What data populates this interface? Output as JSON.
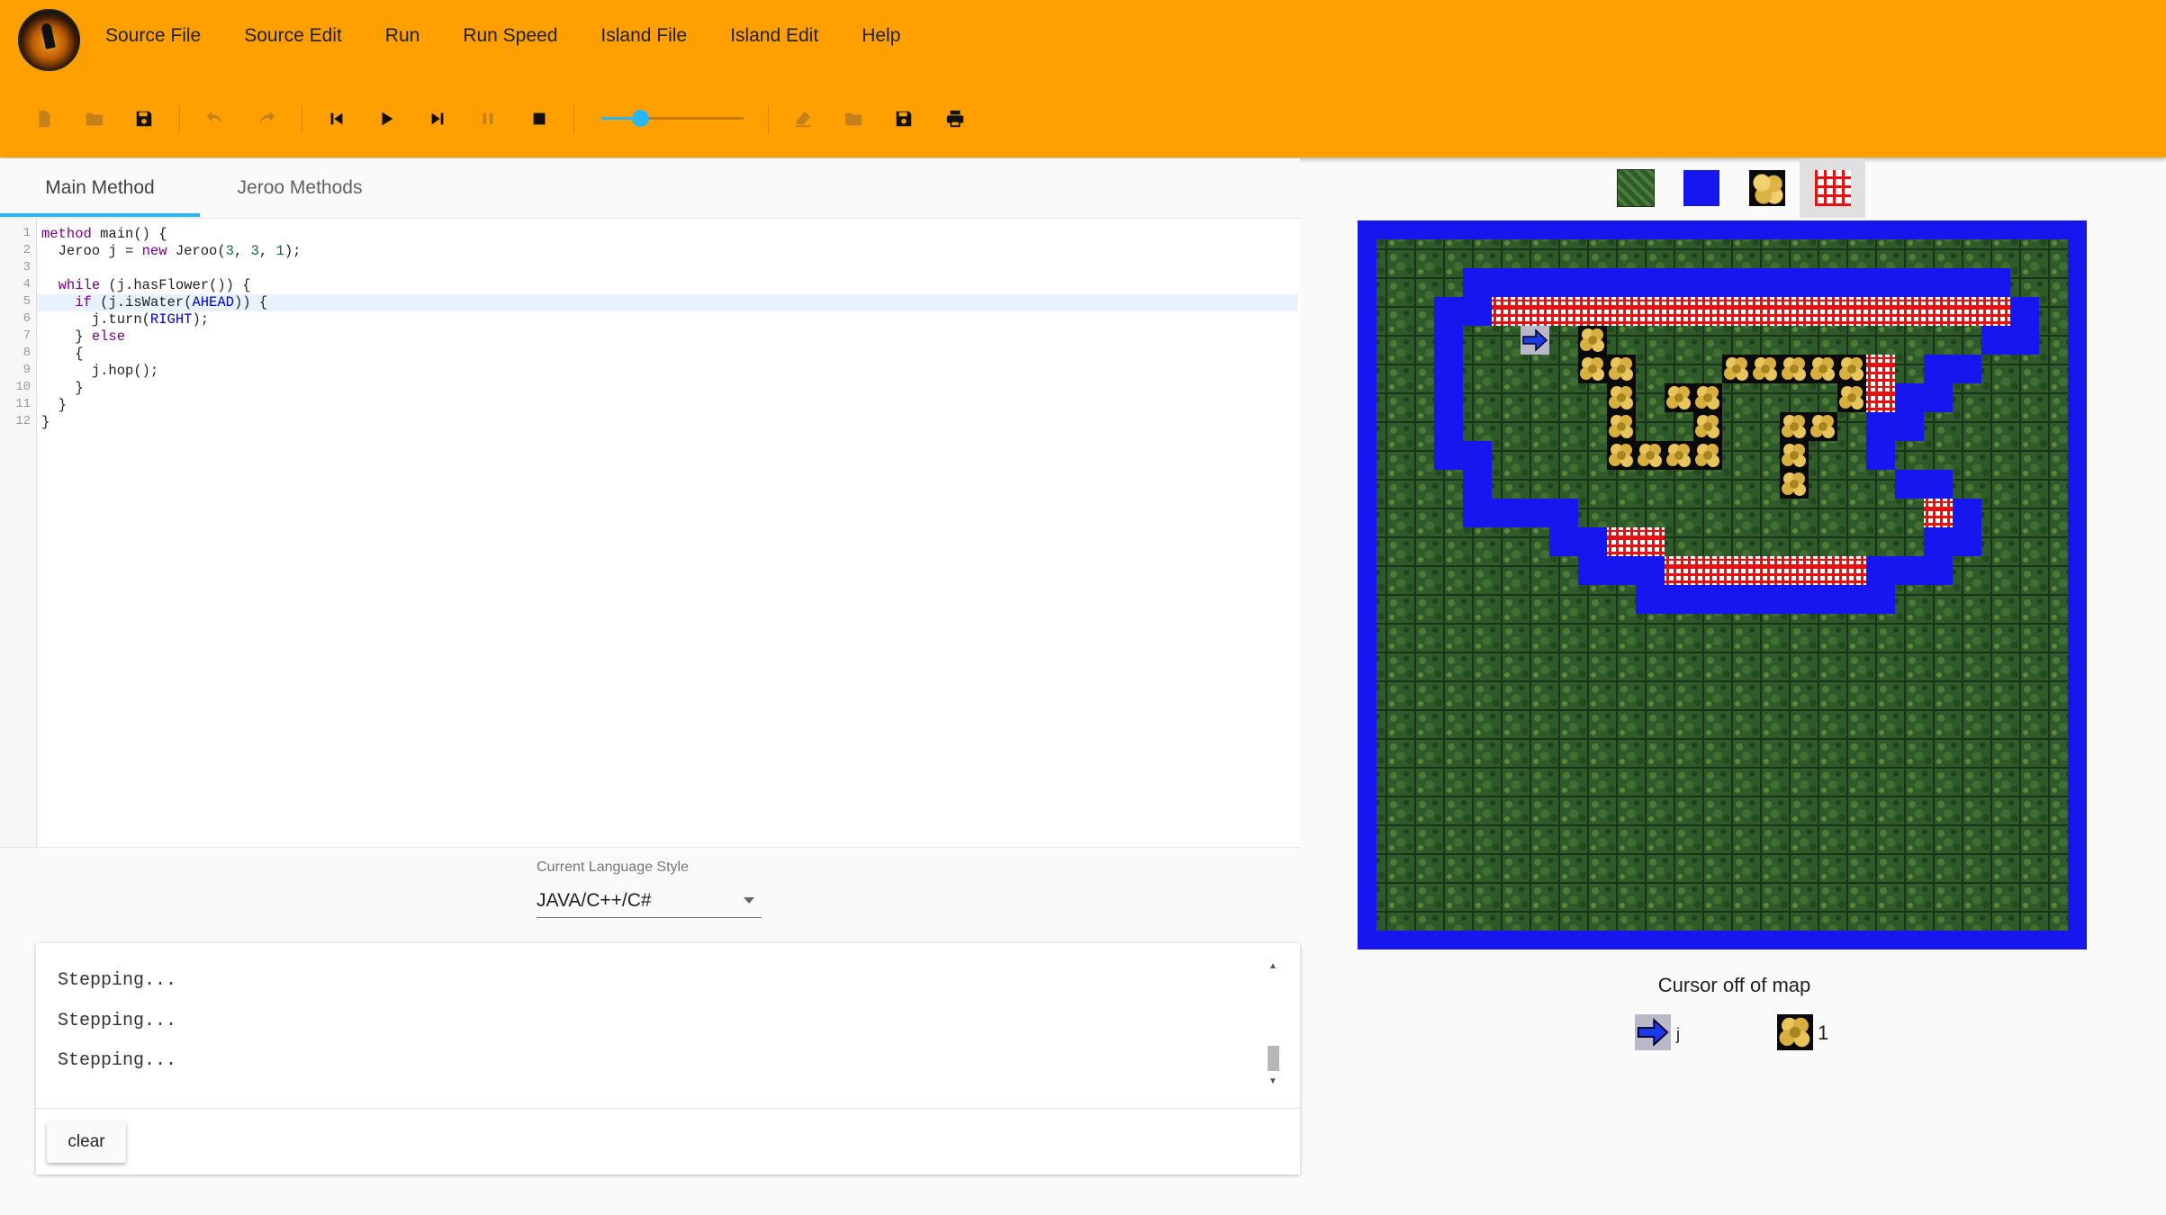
{
  "app": {
    "logo": "jeroo-logo"
  },
  "menu": [
    "Source File",
    "Source Edit",
    "Run",
    "Run Speed",
    "Island File",
    "Island Edit",
    "Help"
  ],
  "toolbar": {
    "icons": [
      "new-file-icon",
      "open-folder-icon",
      "save-icon",
      "undo-icon",
      "redo-icon",
      "reset-icon",
      "play-icon",
      "step-icon",
      "pause-icon",
      "stop-icon",
      "clear-island-icon",
      "open-island-icon",
      "save-island-icon",
      "print-icon"
    ],
    "speed_level": 0.27
  },
  "tabs": {
    "main": "Main Method",
    "jeroo": "Jeroo Methods"
  },
  "editor": {
    "line_numbers": [
      "1",
      "2",
      "3",
      "4",
      "5",
      "6",
      "7",
      "8",
      "9",
      "10",
      "11",
      "12"
    ],
    "current_line": 5,
    "tokens": {
      "l1a": "method",
      "l1b": " main() {",
      "l2a": "  Jeroo j = ",
      "l2b": "new",
      "l2c": " Jeroo(",
      "l2d": "3",
      "l2e": ", ",
      "l2f": "3",
      "l2g": ", ",
      "l2h": "1",
      "l2i": ");",
      "l4a": "  ",
      "l4b": "while",
      "l4c": " (j.hasFlower()) {",
      "l5a": "    ",
      "l5b": "if",
      "l5c": " (j.isWater(",
      "l5d": "AHEAD",
      "l5e": ")) {",
      "l6a": "      j.turn(",
      "l6b": "RIGHT",
      "l6c": ");",
      "l7a": "    } ",
      "l7b": "else",
      "l8": "    {",
      "l9": "      j.hop();",
      "l10": "    }",
      "l11": "  }",
      "l12": "}"
    }
  },
  "language": {
    "label": "Current Language Style",
    "value": "JAVA/C++/C#"
  },
  "console": {
    "lines": [
      "Stepping...",
      "Stepping...",
      "Stepping..."
    ],
    "clear_label": "clear"
  },
  "palette": [
    {
      "name": "grass",
      "color": "#2f5a2a"
    },
    {
      "name": "water",
      "color": "#1616ee"
    },
    {
      "name": "flower",
      "color": "#e8c45a"
    },
    {
      "name": "net",
      "color": "#e81010"
    }
  ],
  "colors": {
    "accent": "#ffa000",
    "water": "#1616ee",
    "grass": "#2a4d27",
    "net": "#e81010",
    "flower": "#e8c45a",
    "ink": "#29b6f6"
  },
  "map": {
    "rows": [
      "WWWWWWWWWWWWWWWWWWWWWWWWWW",
      "WGGGGGGGGGGGGGGGGGGGGGGGGW",
      "WGGGWWWWWWWWWWWWWWWWWWWGGW",
      "WGGWWNNNNNNNNNNNNNNNNNNWGW",
      "WGGWGGJGFGGGGGGGGGGGGGWWGW",
      "WGGWGGGGFFGGGFFFFFNGWWGGGW",
      "WGGWGGGGGFGFFGGGGFNWWGGGGW",
      "WGGWGGGGGFGGFGGFFGWWGGGGGW",
      "WGGWWGGGGFFFFGGFGGWGGGGGGW",
      "WGGGWGGGGGGGGGGFGGGWWGGGGW",
      "WGGGWWWWGGGGGGGGGGGGNWGGGW",
      "WGGGGGGWWNNGGGGGGGGGWWGGGW",
      "WGGGGGGGWWWNNNNNNNWWWGGGGW",
      "WGGGGGGGGGWWWWWWWWWGGGGGGW",
      "WGGGGGGGGGGGGGGGGGGGGGGGGW",
      "WGGGGGGGGGGGGGGGGGGGGGGGGW",
      "WGGGGGGGGGGGGGGGGGGGGGGGGW",
      "WGGGGGGGGGGGGGGGGGGGGGGGGW",
      "WGGGGGGGGGGGGGGGGGGGGGGGGW",
      "WGGGGGGGGGGGGGGGGGGGGGGGGW",
      "WGGGGGGGGGGGGGGGGGGGGGGGGW",
      "WGGGGGGGGGGGGGGGGGGGGGGGGW",
      "WGGGGGGGGGGGGGGGGGGGGGGGGW",
      "WGGGGGGGGGGGGGGGGGGGGGGGGW",
      "WGGGGGGGGGGGGGGGGGGGGGGGGW",
      "WWWWWWWWWWWWWWWWWWWWWWWWWW"
    ],
    "jeroo_direction": "east",
    "status": "Cursor off of map"
  },
  "legend": {
    "jeroo_name": "j",
    "flower_count": "1"
  }
}
